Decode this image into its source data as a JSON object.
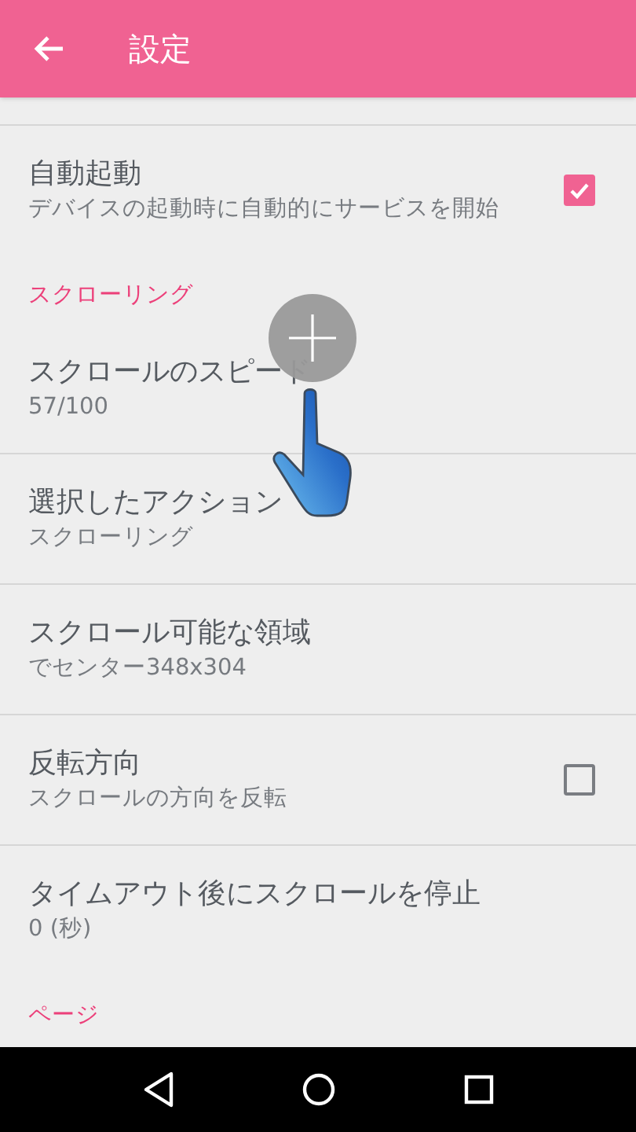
{
  "app_bar": {
    "title": "設定"
  },
  "items": [
    {
      "kind": "checkbox",
      "title": "自動起動",
      "summary": "デバイスの起動時に自動的にサービスを開始",
      "checked": true
    },
    {
      "kind": "category",
      "title": "スクローリング"
    },
    {
      "kind": "setting",
      "title": "スクロールのスピード",
      "summary": "57/100"
    },
    {
      "kind": "setting",
      "title": "選択したアクション",
      "summary": "スクローリング"
    },
    {
      "kind": "setting",
      "title": "スクロール可能な領域",
      "summary": "でセンター348x304"
    },
    {
      "kind": "checkbox",
      "title": "反転方向",
      "summary": "スクロールの方向を反転",
      "checked": false
    },
    {
      "kind": "setting",
      "title": "タイムアウト後にスクロールを停止",
      "summary": "0 (秒)"
    },
    {
      "kind": "category",
      "title": "ページ"
    }
  ]
}
